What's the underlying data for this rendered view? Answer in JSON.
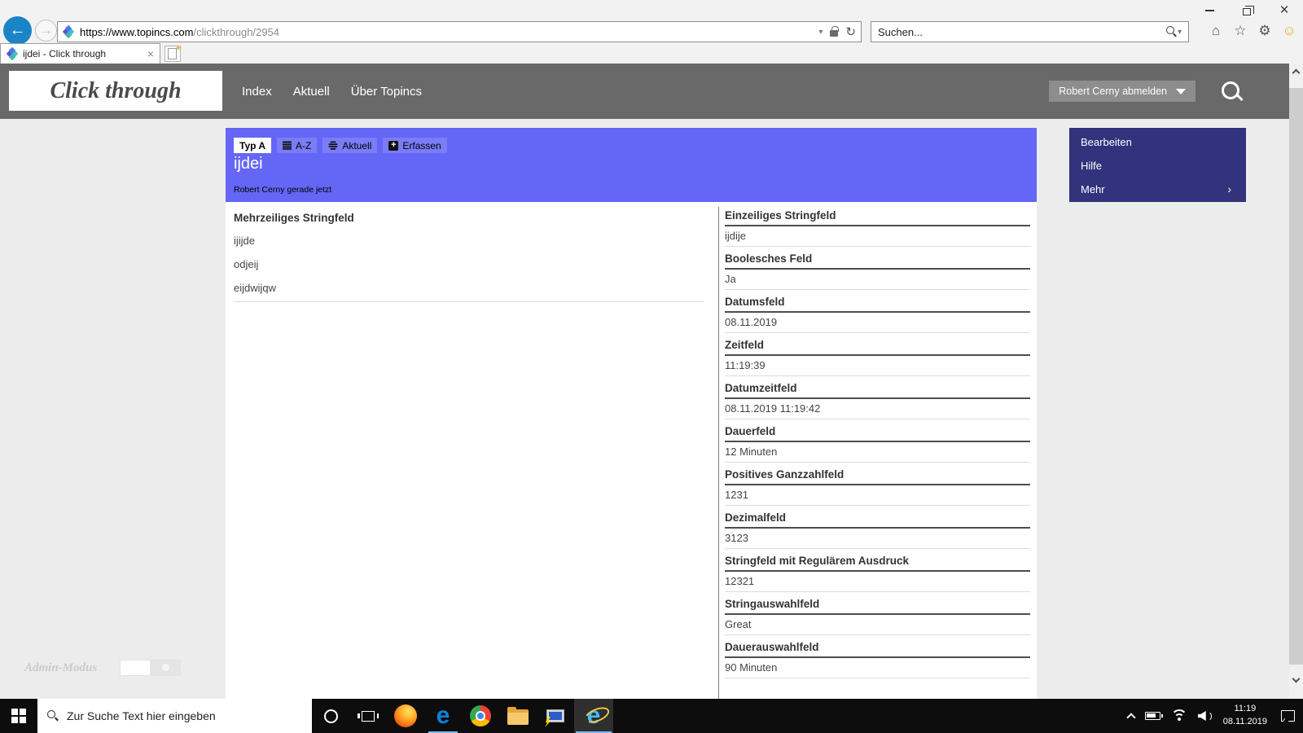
{
  "browser": {
    "url_domain": "https://www.topincs.com",
    "url_path": "/clickthrough/2954",
    "search_placeholder": "Suchen...",
    "tab_title": "ijdei - Click through"
  },
  "site": {
    "logo": "Click through",
    "nav": [
      "Index",
      "Aktuell",
      "Über Topincs"
    ],
    "logout_label": "Robert Cerny abmelden"
  },
  "banner": {
    "type_label": "Typ A",
    "chips": [
      "A-Z",
      "Aktuell",
      "Erfassen"
    ],
    "title": "ijdei",
    "byline": "Robert Cerny gerade jetzt"
  },
  "side_menu": [
    "Bearbeiten",
    "Hilfe",
    "Mehr"
  ],
  "content": {
    "left": {
      "label": "Mehrzeiliges Stringfeld",
      "values": [
        "ijijde",
        "odjeij",
        "eijdwijqw"
      ]
    },
    "fields": [
      {
        "label": "Einzeiliges Stringfeld",
        "value": "ijdije"
      },
      {
        "label": "Boolesches Feld",
        "value": "Ja"
      },
      {
        "label": "Datumsfeld",
        "value": "08.11.2019"
      },
      {
        "label": "Zeitfeld",
        "value": "11:19:39"
      },
      {
        "label": "Datumzeitfeld",
        "value": "08.11.2019 11:19:42"
      },
      {
        "label": "Dauerfeld",
        "value": "12 Minuten"
      },
      {
        "label": "Positives Ganzzahlfeld",
        "value": "1231"
      },
      {
        "label": "Dezimalfeld",
        "value": "3123"
      },
      {
        "label": "Stringfeld mit Regulärem Ausdruck",
        "value": "12321"
      },
      {
        "label": "Stringauswahlfeld",
        "value": "Great"
      },
      {
        "label": "Dauerauswahlfeld",
        "value": "90 Minuten"
      }
    ]
  },
  "admin": {
    "label": "Admin-Modus"
  },
  "taskbar": {
    "search_placeholder": "Zur Suche Text hier eingeben",
    "time": "11:19",
    "date": "08.11.2019"
  },
  "colors": {
    "banner_purple": "#6466f6",
    "chip_purple": "#7b7df8",
    "menu_navy": "#32327d",
    "header_gray": "#696969",
    "back_button_blue": "#1b84c6",
    "taskbar_black": "#0d0d0d",
    "active_underline_blue": "#76b9ed"
  }
}
